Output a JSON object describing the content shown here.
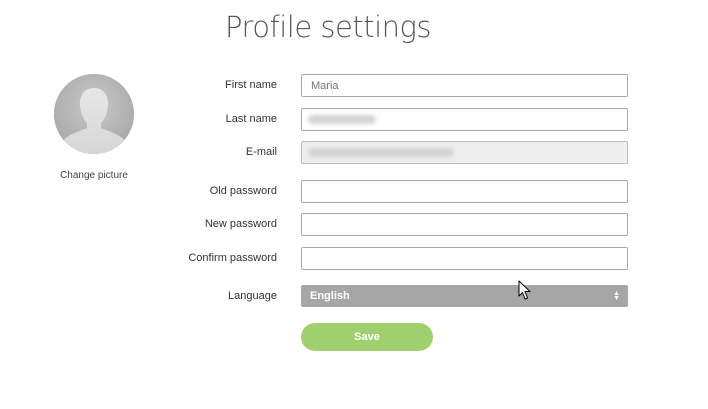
{
  "page": {
    "title": "Profile settings"
  },
  "avatar": {
    "icon": "user-silhouette-icon",
    "change_picture_label": "Change picture"
  },
  "form": {
    "first_name": {
      "label": "First name",
      "value": "Maria",
      "placeholder": "Maria"
    },
    "last_name": {
      "label": "Last name",
      "value": ""
    },
    "email": {
      "label": "E-mail",
      "value": ""
    },
    "old_password": {
      "label": "Old password",
      "value": ""
    },
    "new_password": {
      "label": "New password",
      "value": ""
    },
    "confirm_password": {
      "label": "Confirm password",
      "value": ""
    },
    "language": {
      "label": "Language",
      "selected": "English",
      "icon": "select-arrows-icon"
    }
  },
  "actions": {
    "save_label": "Save"
  },
  "colors": {
    "save_button": "#a0cf6e",
    "select_background": "#a6a6a6",
    "disabled_input": "#eeeeee"
  }
}
